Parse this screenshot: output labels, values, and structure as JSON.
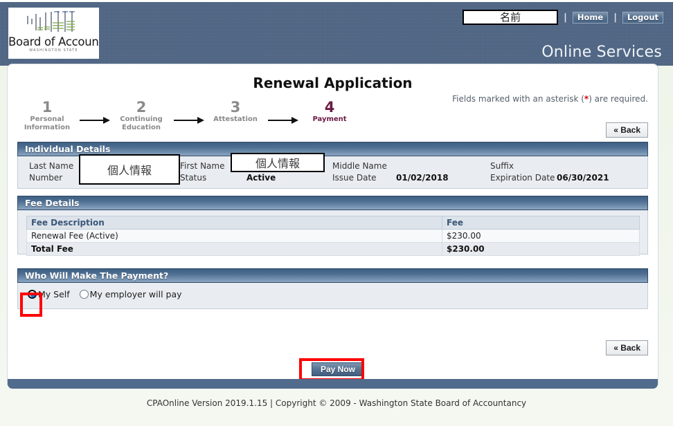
{
  "header": {
    "logo": {
      "title": "Board of Accountancy",
      "subtitle": "WASHINGTON STATE",
      "graphic_icon": "bar-chart-tally-icon"
    },
    "name_field_value": "名前",
    "separator": "|",
    "nav": [
      {
        "label": "Home",
        "name": "home-link"
      },
      {
        "label": "Logout",
        "name": "logout-link"
      }
    ],
    "brand_tagline": "Online Services"
  },
  "content": {
    "page_title": "Renewal Application",
    "required_note_prefix": "Fields marked with an asterisk (",
    "required_note_asterisk": "*",
    "required_note_suffix": ") are required.",
    "back_button": "« Back",
    "back_button_bottom": "« Back",
    "pay_now_button": "Pay Now"
  },
  "steps": [
    {
      "num": "1",
      "label": "Personal Information",
      "active": false
    },
    {
      "num": "2",
      "label": "Continuing Education",
      "active": false
    },
    {
      "num": "3",
      "label": "Attestation",
      "active": false
    },
    {
      "num": "4",
      "label": "Payment",
      "active": true
    }
  ],
  "individual_details": {
    "section_title": "Individual Details",
    "last_name_label": "Last Name",
    "last_name_value": "個人情報",
    "number_label": "Number",
    "number_value": "",
    "first_name_label": "First Name",
    "first_name_value": "個人情報",
    "status_label": "Status",
    "status_value": "Active",
    "middle_name_label": "Middle Name",
    "middle_name_value": "",
    "issue_date_label": "Issue Date",
    "issue_date_value": "01/02/2018",
    "suffix_label": "Suffix",
    "suffix_value": "",
    "expiration_date_label": "Expiration Date",
    "expiration_date_value": "06/30/2021"
  },
  "fee_details": {
    "section_title": "Fee Details",
    "columns": [
      "Fee Description",
      "Fee"
    ],
    "rows": [
      {
        "description": "Renewal Fee (Active)",
        "fee": "$230.00",
        "total": false
      },
      {
        "description": "Total Fee",
        "fee": "$230.00",
        "total": true
      }
    ]
  },
  "payment": {
    "section_title": "Who Will Make The Payment?",
    "options": [
      {
        "label": "My Self",
        "selected": true
      },
      {
        "label": "My employer will pay",
        "selected": false
      }
    ]
  },
  "footer": {
    "text": "CPAOnline Version 2019.1.15 | Copyright © 2009 - Washington State Board of Accountancy"
  },
  "colors": {
    "header_blue": "#4c6484",
    "section_bar_blue": "#4e6f92",
    "active_step_maroon": "#6b1b45",
    "inactive_step_gray": "#8a8a8a",
    "annotation_red": "#ff0000",
    "radio_blue": "#1372e8",
    "page_background": "#f3f7f0"
  }
}
